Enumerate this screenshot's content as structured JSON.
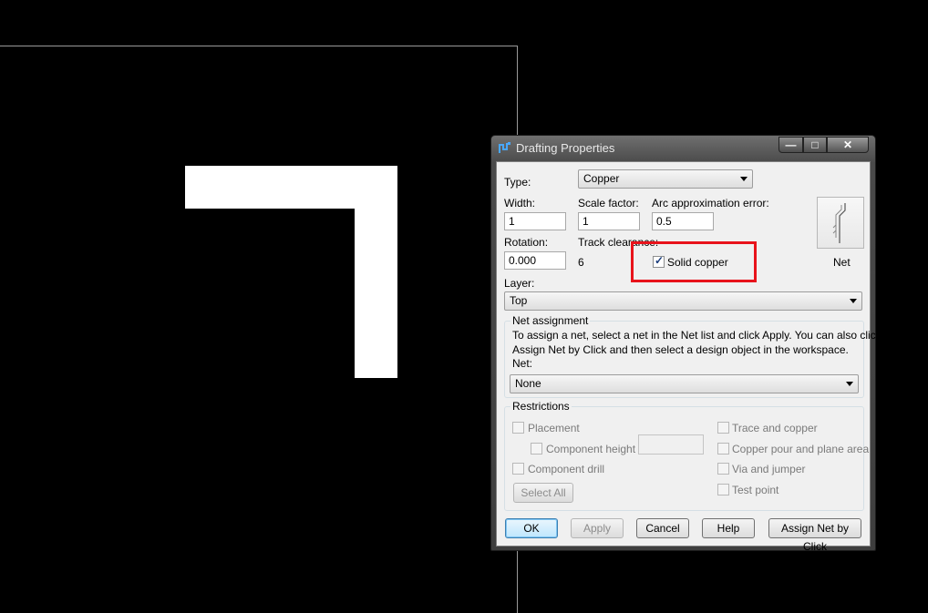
{
  "dialog": {
    "title": "Drafting Properties",
    "window_buttons": {
      "minimize": "—",
      "maximize": "□",
      "close": "✕"
    }
  },
  "form": {
    "type_label": "Type:",
    "type_value": "Copper",
    "width_label": "Width:",
    "width_value": "1",
    "scale_label": "Scale factor:",
    "scale_value": "1",
    "arc_label": "Arc approximation error:",
    "arc_value": "0.5",
    "rotation_label": "Rotation:",
    "rotation_value": "0.000",
    "track_label": "Track clearance:",
    "track_value": "6",
    "solid_copper_label": "Solid copper",
    "solid_copper_checked": true,
    "layer_label": "Layer:",
    "layer_value": "Top",
    "net_button_label": "Net"
  },
  "net_assignment": {
    "title": "Net assignment",
    "description_line1": "To assign a net, select a net in the Net list and click Apply. You can also click",
    "description_line2": "Assign Net by Click and then select a design object in the workspace.",
    "net_label": "Net:",
    "net_value": "None"
  },
  "restrictions": {
    "title": "Restrictions",
    "placement": "Placement",
    "component_height": "Component height",
    "component_drill": "Component drill",
    "trace_and_copper": "Trace and copper",
    "copper_pour": "Copper pour and plane area",
    "via_and_jumper": "Via and jumper",
    "test_point": "Test point",
    "select_all": "Select All"
  },
  "buttons": {
    "ok": "OK",
    "apply": "Apply",
    "cancel": "Cancel",
    "help": "Help",
    "assign_net": "Assign Net by Click"
  },
  "colors": {
    "background": "#000000",
    "copper": "#ffffff",
    "highlight": "#e8131b"
  }
}
